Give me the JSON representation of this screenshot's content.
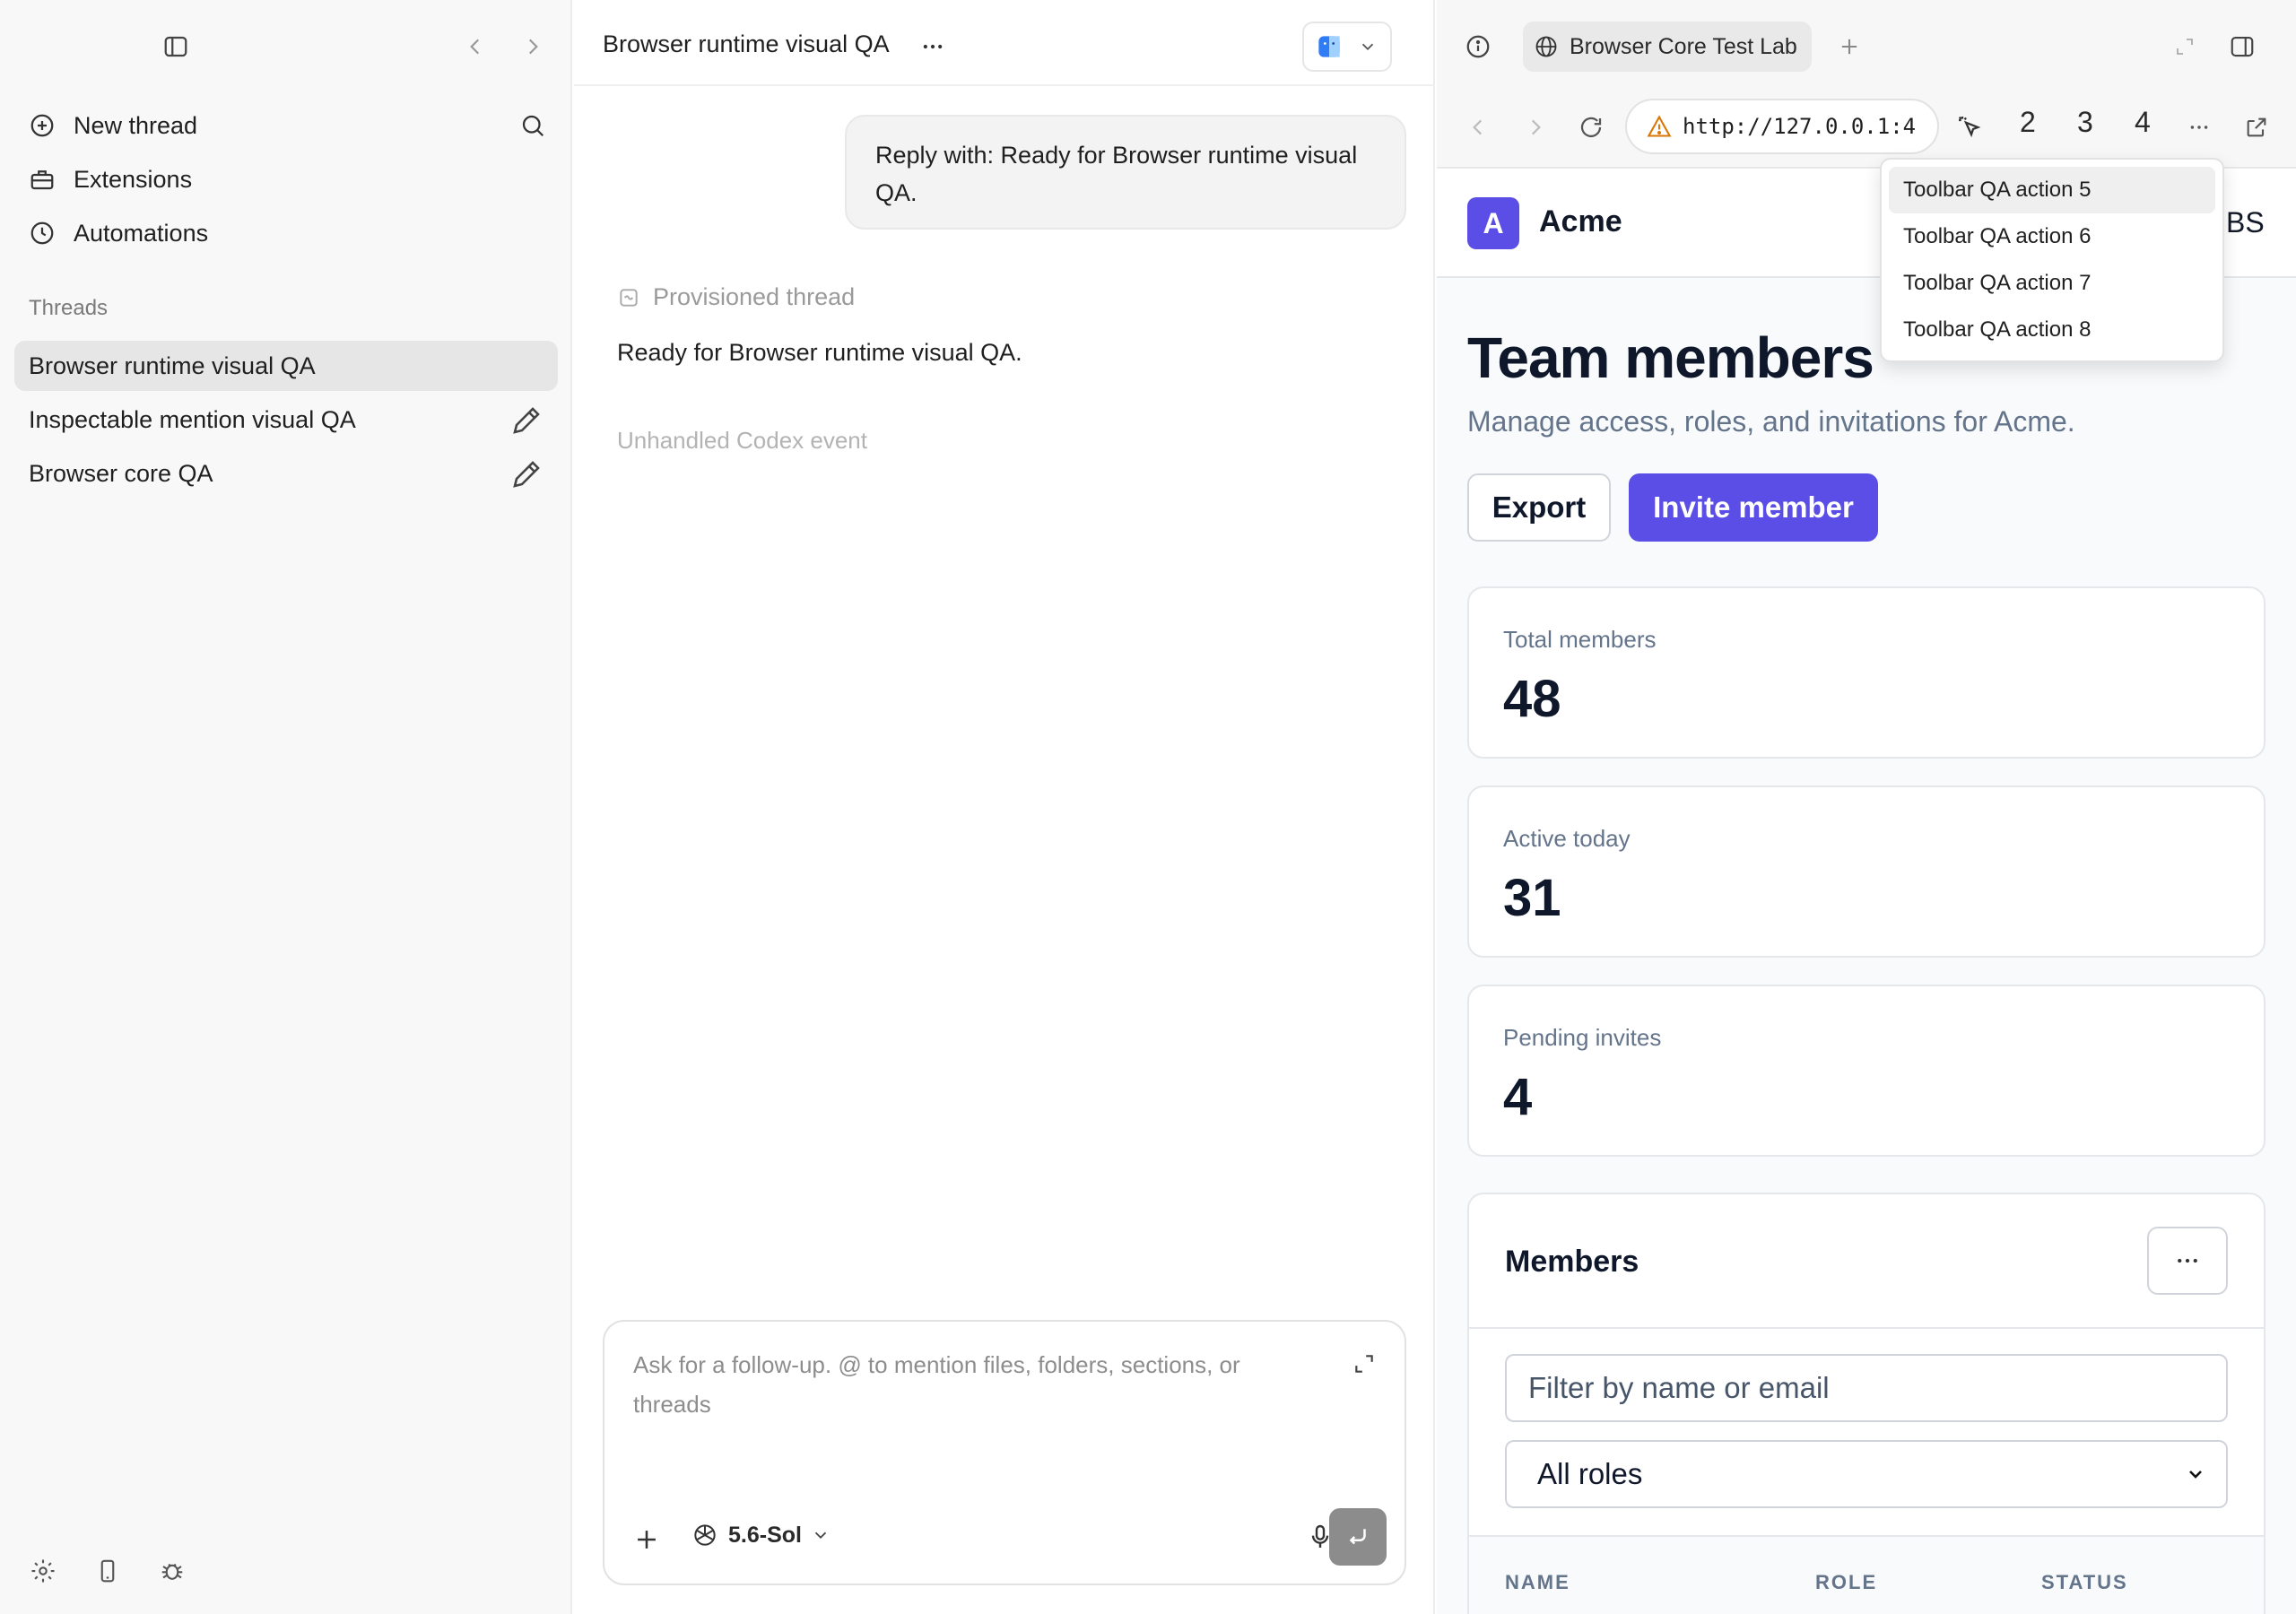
{
  "sidebar": {
    "nav": [
      {
        "label": "New thread",
        "icon": "plus-circle-icon"
      },
      {
        "label": "Extensions",
        "icon": "toolbox-icon"
      },
      {
        "label": "Automations",
        "icon": "clock-icon"
      }
    ],
    "section_label": "Threads",
    "threads": [
      {
        "label": "Browser runtime visual QA",
        "active": true
      },
      {
        "label": "Inspectable mention visual QA",
        "active": false
      },
      {
        "label": "Browser core QA",
        "active": false
      }
    ]
  },
  "chat": {
    "title": "Browser runtime visual QA",
    "user_message": "Reply with: Ready for Browser runtime visual QA.",
    "provisioned_label": "Provisioned thread",
    "assistant_reply": "Ready for Browser runtime visual QA.",
    "unhandled_event": "Unhandled Codex event",
    "composer": {
      "placeholder": "Ask for a follow-up. @ to mention files, folders, sections, or threads",
      "model_label": "5.6-Sol"
    }
  },
  "browser": {
    "tab_title": "Browser Core Test Lab",
    "url": "http://127.0.0.1:4",
    "toolbar_numbers": [
      "2",
      "3",
      "4"
    ],
    "dropdown_items": [
      "Toolbar QA action 5",
      "Toolbar QA action 6",
      "Toolbar QA action 7",
      "Toolbar QA action 8"
    ],
    "page": {
      "logo_letter": "A",
      "brand": "Acme",
      "header_right": "BS",
      "heading": "Team members",
      "subtitle": "Manage access, roles, and invitations for Acme.",
      "export_label": "Export",
      "invite_label": "Invite member",
      "stats": [
        {
          "label": "Total members",
          "value": "48"
        },
        {
          "label": "Active today",
          "value": "31"
        },
        {
          "label": "Pending invites",
          "value": "4"
        }
      ],
      "members": {
        "title": "Members",
        "filter_placeholder": "Filter by name or email",
        "role_select": "All roles",
        "columns": [
          "NAME",
          "ROLE",
          "STATUS"
        ]
      }
    }
  },
  "colors": {
    "accent": "#5b4ee6",
    "sidebar_bg": "#f8f8f8",
    "active_thread_bg": "#e6e6e6"
  }
}
